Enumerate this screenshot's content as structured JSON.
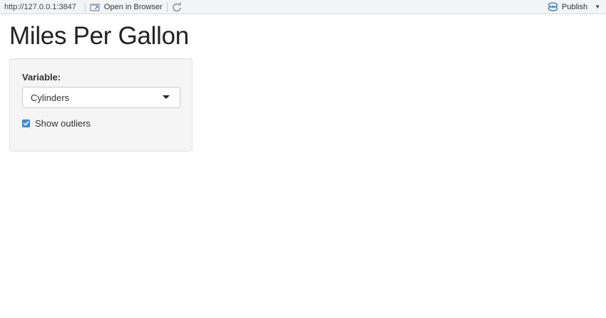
{
  "toolbar": {
    "url": "http://127.0.0.1:3847",
    "open_in_browser_label": "Open in Browser",
    "publish_label": "Publish"
  },
  "page": {
    "title": "Miles Per Gallon"
  },
  "sidebar": {
    "variable_label": "Variable:",
    "variable_selected": "Cylinders",
    "show_outliers_label": "Show outliers",
    "show_outliers_checked": true
  },
  "colors": {
    "checkbox_accent": "#3a8ee6",
    "publish_icon": "#4a8ccf"
  }
}
